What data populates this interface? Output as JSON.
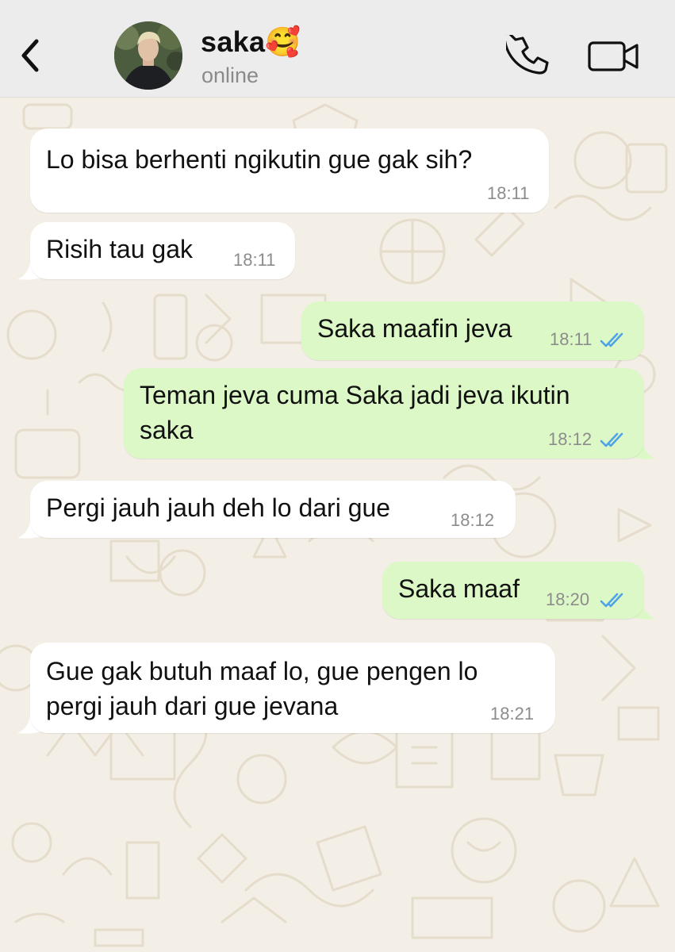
{
  "header": {
    "contact_name": "saka🥰",
    "status": "online"
  },
  "icons": {
    "back": "chevron-left-icon",
    "call": "phone-icon",
    "video": "video-camera-icon",
    "read_receipt": "double-check-icon"
  },
  "colors": {
    "incoming_bubble": "#ffffff",
    "outgoing_bubble": "#dcf8c6",
    "read_ticks": "#4fa3e6",
    "chat_background": "#f3efe6",
    "header_background": "#ececec"
  },
  "messages": [
    {
      "direction": "incoming",
      "text": "Lo bisa berhenti ngikutin gue gak sih?",
      "time": "18:11"
    },
    {
      "direction": "incoming",
      "text": "Risih tau gak",
      "time": "18:11"
    },
    {
      "direction": "outgoing",
      "text": "Saka maafin jeva",
      "time": "18:11",
      "read": true
    },
    {
      "direction": "outgoing",
      "text_lines": [
        "Teman jeva cuma Saka jadi jeva ikutin",
        "saka"
      ],
      "time": "18:12",
      "read": true
    },
    {
      "direction": "incoming",
      "text": "Pergi jauh jauh deh lo dari gue",
      "time": "18:12"
    },
    {
      "direction": "outgoing",
      "text": "Saka maaf",
      "time": "18:20",
      "read": true
    },
    {
      "direction": "incoming",
      "text_lines": [
        "Gue gak butuh maaf lo, gue pengen lo",
        "pergi jauh dari gue jevana"
      ],
      "time": "18:21"
    }
  ]
}
